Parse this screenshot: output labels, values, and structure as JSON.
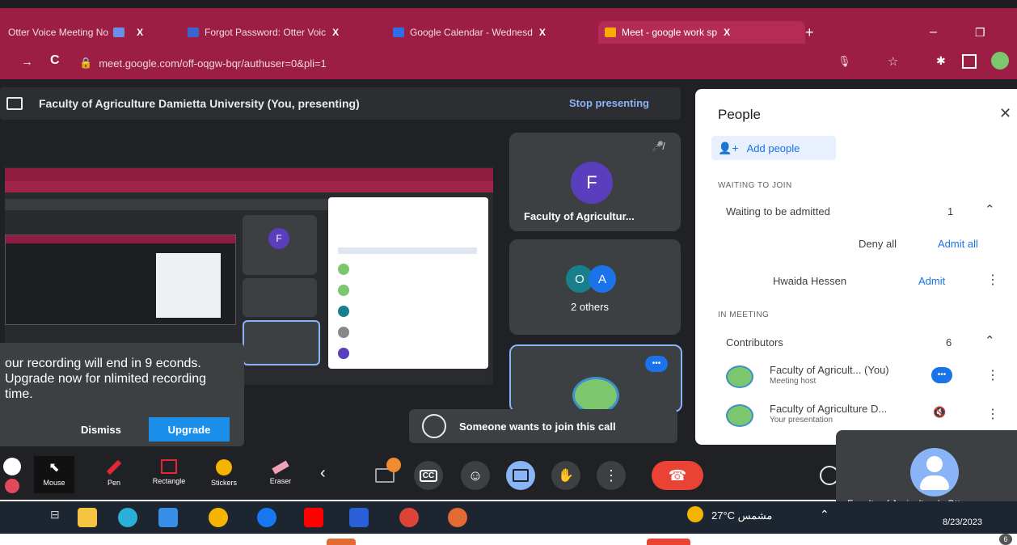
{
  "tabs": [
    {
      "label": "Otter Voice Meeting No",
      "close": "X"
    },
    {
      "label": "Forgot Password: Otter Voic",
      "close": "X"
    },
    {
      "label": "Google Calendar - Wednesd",
      "close": "X"
    },
    {
      "label": "Meet - google work sp",
      "close": "X"
    }
  ],
  "new_tab": "+",
  "url": "meet.google.com/off-oqgw-bqr/authuser=0&pli=1",
  "present_bar": {
    "title": "Faculty of Agriculture Damietta University (You, presenting)",
    "stop": "Stop presenting"
  },
  "tiles": {
    "main": {
      "initial": "F",
      "name": "Faculty of Agricultur..."
    },
    "others": {
      "initial_a": "O",
      "initial_b": "A",
      "label": "2 others"
    },
    "more": "•••"
  },
  "people_panel": {
    "title": "People",
    "close": "✕",
    "add_people": "Add people",
    "waiting_heading": "WAITING TO JOIN",
    "waiting_label": "Waiting to be admitted",
    "waiting_count": "1",
    "deny_all": "Deny all",
    "admit_all": "Admit all",
    "waiting_person": "Hwaida Hessen",
    "admit": "Admit",
    "in_meeting_heading": "IN MEETING",
    "contributors_label": "Contributors",
    "contributors_count": "6",
    "members": [
      {
        "name": "Faculty of Agricult... (You)",
        "sub": "Meeting host"
      },
      {
        "name": "Faculty of Agriculture D...",
        "sub": "Your presentation"
      }
    ]
  },
  "toast": {
    "message": "our recording will end in 9 econds. Upgrade now for nlimited recording time.",
    "dismiss": "Dismiss",
    "upgrade": "Upgrade"
  },
  "join_notice": "Someone wants to join this call",
  "tools": [
    {
      "label": "Mouse"
    },
    {
      "label": "Pen"
    },
    {
      "label": "Rectangle"
    },
    {
      "label": "Stickers"
    },
    {
      "label": "Eraser"
    }
  ],
  "cc_label": "CC",
  "self_view_name": "Faculty of Agriculture's Otte",
  "taskbar": {
    "weather": "27°C مشمس",
    "date": "8/23/2023",
    "badge": "6"
  },
  "colors": {
    "chrome": "#9c1e45",
    "meet_bg": "#202124",
    "accent_blue": "#1a73e8",
    "avatar_purple": "#5a3ebd",
    "avatar_teal": "#1a7f8c",
    "end_call": "#ea4335"
  }
}
